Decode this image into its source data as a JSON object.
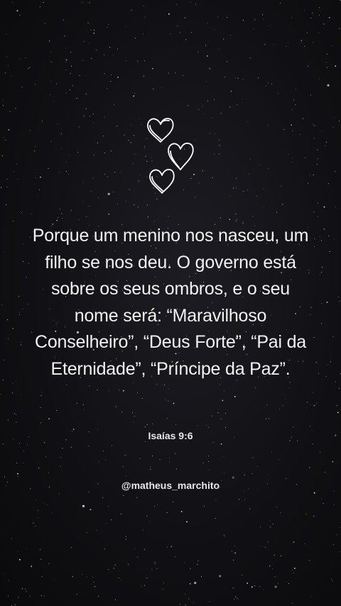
{
  "post": {
    "quote": "Porque um menino nos nasceu, um filho se nos deu. O governo está sobre os seus ombros, e o seu nome será: “Maravilhoso Conselheiro”, “Deus Forte”, “Pai da Eternidade”, “Príncipe da Paz”.",
    "reference": "Isaías 9:6",
    "author_handle": "@matheus_marchito"
  },
  "decoration": {
    "icon": "hearts-icon",
    "background": "starry-night-sky",
    "colors": {
      "background": "#0d0d10",
      "text": "#f2f2f2"
    }
  }
}
